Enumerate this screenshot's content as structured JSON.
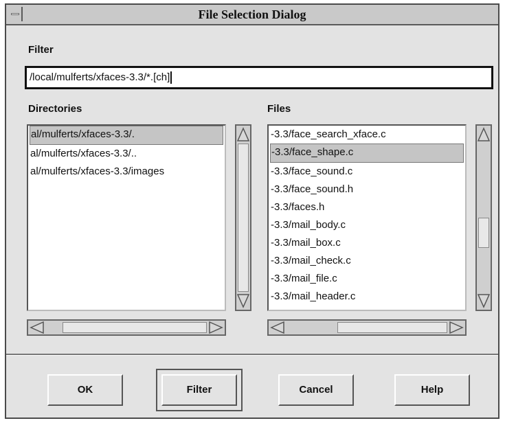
{
  "window": {
    "title": "File Selection Dialog"
  },
  "filter": {
    "label": "Filter",
    "value": "/local/mulferts/xfaces-3.3/*.[ch]"
  },
  "directories": {
    "label": "Directories",
    "items": [
      "al/mulferts/xfaces-3.3/.",
      "al/mulferts/xfaces-3.3/..",
      "al/mulferts/xfaces-3.3/images"
    ],
    "selected_index": 0
  },
  "files": {
    "label": "Files",
    "items": [
      "-3.3/face_search_xface.c",
      "-3.3/face_shape.c",
      "-3.3/face_sound.c",
      "-3.3/face_sound.h",
      "-3.3/faces.h",
      "-3.3/mail_body.c",
      "-3.3/mail_box.c",
      "-3.3/mail_check.c",
      "-3.3/mail_file.c",
      "-3.3/mail_header.c"
    ],
    "selected_index": 1
  },
  "buttons": {
    "ok": "OK",
    "filter": "Filter",
    "cancel": "Cancel",
    "help": "Help"
  },
  "icons": {
    "window_menu": "window-menu-icon",
    "scroll_up": "up-triangle-icon",
    "scroll_down": "down-triangle-icon",
    "scroll_left": "left-triangle-icon",
    "scroll_right": "right-triangle-icon"
  }
}
